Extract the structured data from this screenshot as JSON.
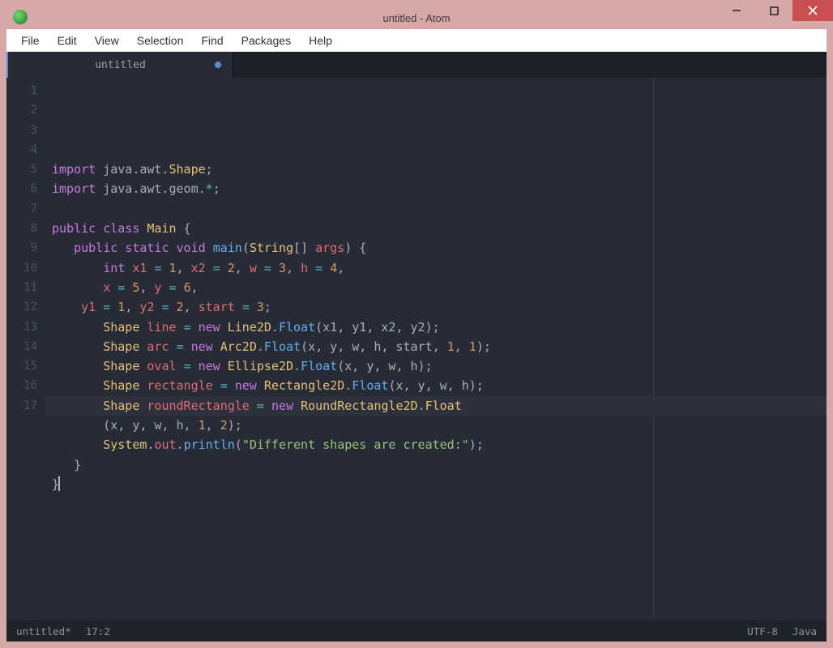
{
  "window": {
    "title": "untitled - Atom"
  },
  "menu": {
    "file": "File",
    "edit": "Edit",
    "view": "View",
    "selection": "Selection",
    "find": "Find",
    "packages": "Packages",
    "help": "Help"
  },
  "tab": {
    "name": "untitled",
    "dirty": true
  },
  "gutter_start": 1,
  "gutter_end": 17,
  "code_lines": [
    [
      [
        "kw",
        "import"
      ],
      [
        "pkg",
        " java"
      ],
      [
        "punct",
        "."
      ],
      [
        "pkg",
        "awt"
      ],
      [
        "punct",
        "."
      ],
      [
        "type",
        "Shape"
      ],
      [
        "punct",
        ";"
      ]
    ],
    [
      [
        "kw",
        "import"
      ],
      [
        "pkg",
        " java"
      ],
      [
        "punct",
        "."
      ],
      [
        "pkg",
        "awt"
      ],
      [
        "punct",
        "."
      ],
      [
        "pkg",
        "geom"
      ],
      [
        "punct",
        "."
      ],
      [
        "op",
        "*"
      ],
      [
        "punct",
        ";"
      ]
    ],
    [],
    [
      [
        "kw",
        "public"
      ],
      [
        "punct",
        " "
      ],
      [
        "kw",
        "class"
      ],
      [
        "punct",
        " "
      ],
      [
        "type",
        "Main"
      ],
      [
        "punct",
        " {"
      ]
    ],
    [
      [
        "punct",
        "   "
      ],
      [
        "kw",
        "public"
      ],
      [
        "punct",
        " "
      ],
      [
        "kw",
        "static"
      ],
      [
        "punct",
        " "
      ],
      [
        "kw",
        "void"
      ],
      [
        "punct",
        " "
      ],
      [
        "fn",
        "main"
      ],
      [
        "punct",
        "("
      ],
      [
        "type",
        "String"
      ],
      [
        "punct",
        "[] "
      ],
      [
        "id",
        "args"
      ],
      [
        "punct",
        ") {"
      ]
    ],
    [
      [
        "punct",
        "       "
      ],
      [
        "kw",
        "int"
      ],
      [
        "punct",
        " "
      ],
      [
        "id",
        "x1"
      ],
      [
        "punct",
        " "
      ],
      [
        "op",
        "="
      ],
      [
        "punct",
        " "
      ],
      [
        "num",
        "1"
      ],
      [
        "punct",
        ", "
      ],
      [
        "id",
        "x2"
      ],
      [
        "punct",
        " "
      ],
      [
        "op",
        "="
      ],
      [
        "punct",
        " "
      ],
      [
        "num",
        "2"
      ],
      [
        "punct",
        ", "
      ],
      [
        "id",
        "w"
      ],
      [
        "punct",
        " "
      ],
      [
        "op",
        "="
      ],
      [
        "punct",
        " "
      ],
      [
        "num",
        "3"
      ],
      [
        "punct",
        ", "
      ],
      [
        "id",
        "h"
      ],
      [
        "punct",
        " "
      ],
      [
        "op",
        "="
      ],
      [
        "punct",
        " "
      ],
      [
        "num",
        "4"
      ],
      [
        "punct",
        ","
      ]
    ],
    [
      [
        "punct",
        "       "
      ],
      [
        "id",
        "x"
      ],
      [
        "punct",
        " "
      ],
      [
        "op",
        "="
      ],
      [
        "punct",
        " "
      ],
      [
        "num",
        "5"
      ],
      [
        "punct",
        ", "
      ],
      [
        "id",
        "y"
      ],
      [
        "punct",
        " "
      ],
      [
        "op",
        "="
      ],
      [
        "punct",
        " "
      ],
      [
        "num",
        "6"
      ],
      [
        "punct",
        ","
      ]
    ],
    [
      [
        "punct",
        "    "
      ],
      [
        "id",
        "y1"
      ],
      [
        "punct",
        " "
      ],
      [
        "op",
        "="
      ],
      [
        "punct",
        " "
      ],
      [
        "num",
        "1"
      ],
      [
        "punct",
        ", "
      ],
      [
        "id",
        "y2"
      ],
      [
        "punct",
        " "
      ],
      [
        "op",
        "="
      ],
      [
        "punct",
        " "
      ],
      [
        "num",
        "2"
      ],
      [
        "punct",
        ", "
      ],
      [
        "id",
        "start"
      ],
      [
        "punct",
        " "
      ],
      [
        "op",
        "="
      ],
      [
        "punct",
        " "
      ],
      [
        "num",
        "3"
      ],
      [
        "punct",
        ";"
      ]
    ],
    [
      [
        "punct",
        "       "
      ],
      [
        "type",
        "Shape"
      ],
      [
        "punct",
        " "
      ],
      [
        "id",
        "line"
      ],
      [
        "punct",
        " "
      ],
      [
        "op",
        "="
      ],
      [
        "punct",
        " "
      ],
      [
        "kw",
        "new"
      ],
      [
        "punct",
        " "
      ],
      [
        "type",
        "Line2D"
      ],
      [
        "punct",
        "."
      ],
      [
        "fn",
        "Float"
      ],
      [
        "punct",
        "(x1, y1, x2, y2);"
      ]
    ],
    [
      [
        "punct",
        "       "
      ],
      [
        "type",
        "Shape"
      ],
      [
        "punct",
        " "
      ],
      [
        "id",
        "arc"
      ],
      [
        "punct",
        " "
      ],
      [
        "op",
        "="
      ],
      [
        "punct",
        " "
      ],
      [
        "kw",
        "new"
      ],
      [
        "punct",
        " "
      ],
      [
        "type",
        "Arc2D"
      ],
      [
        "punct",
        "."
      ],
      [
        "fn",
        "Float"
      ],
      [
        "punct",
        "(x, y, w, h, start, "
      ],
      [
        "num",
        "1"
      ],
      [
        "punct",
        ", "
      ],
      [
        "num",
        "1"
      ],
      [
        "punct",
        ");"
      ]
    ],
    [
      [
        "punct",
        "       "
      ],
      [
        "type",
        "Shape"
      ],
      [
        "punct",
        " "
      ],
      [
        "id",
        "oval"
      ],
      [
        "punct",
        " "
      ],
      [
        "op",
        "="
      ],
      [
        "punct",
        " "
      ],
      [
        "kw",
        "new"
      ],
      [
        "punct",
        " "
      ],
      [
        "type",
        "Ellipse2D"
      ],
      [
        "punct",
        "."
      ],
      [
        "fn",
        "Float"
      ],
      [
        "punct",
        "(x, y, w, h);"
      ]
    ],
    [
      [
        "punct",
        "       "
      ],
      [
        "type",
        "Shape"
      ],
      [
        "punct",
        " "
      ],
      [
        "id",
        "rectangle"
      ],
      [
        "punct",
        " "
      ],
      [
        "op",
        "="
      ],
      [
        "punct",
        " "
      ],
      [
        "kw",
        "new"
      ],
      [
        "punct",
        " "
      ],
      [
        "type",
        "Rectangle2D"
      ],
      [
        "punct",
        "."
      ],
      [
        "fn",
        "Float"
      ],
      [
        "punct",
        "(x, y, w, h);"
      ]
    ],
    [
      [
        "punct",
        "       "
      ],
      [
        "type",
        "Shape"
      ],
      [
        "punct",
        " "
      ],
      [
        "id",
        "roundRectangle"
      ],
      [
        "punct",
        " "
      ],
      [
        "op",
        "="
      ],
      [
        "punct",
        " "
      ],
      [
        "kw",
        "new"
      ],
      [
        "punct",
        " "
      ],
      [
        "type",
        "RoundRectangle2D"
      ],
      [
        "punct",
        "."
      ],
      [
        "type",
        "Float"
      ]
    ],
    [
      [
        "punct",
        "       (x, y, w, h, "
      ],
      [
        "num",
        "1"
      ],
      [
        "punct",
        ", "
      ],
      [
        "num",
        "2"
      ],
      [
        "punct",
        ");"
      ]
    ],
    [
      [
        "punct",
        "       "
      ],
      [
        "type",
        "System"
      ],
      [
        "punct",
        "."
      ],
      [
        "prop",
        "out"
      ],
      [
        "punct",
        "."
      ],
      [
        "fn",
        "println"
      ],
      [
        "punct",
        "("
      ],
      [
        "str",
        "\"Different shapes are created:\""
      ],
      [
        "punct",
        ");"
      ]
    ],
    [
      [
        "punct",
        "   }"
      ]
    ],
    [
      [
        "punct",
        "}"
      ]
    ]
  ],
  "status": {
    "filename": "untitled*",
    "cursor": "17:2",
    "encoding": "UTF-8",
    "grammar": "Java"
  }
}
